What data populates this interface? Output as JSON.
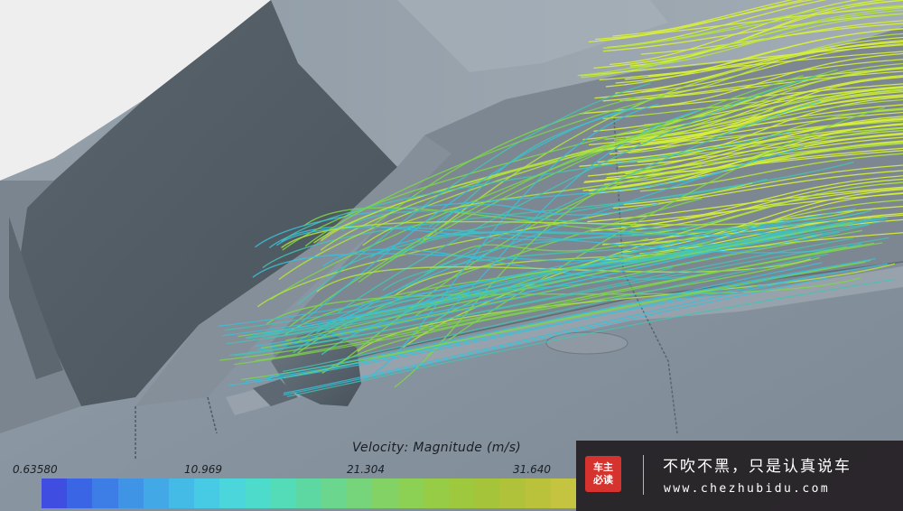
{
  "legend": {
    "title": "Velocity: Magnitude (m/s)",
    "ticks": [
      "0.63580",
      "10.969",
      "21.304",
      "31.640"
    ],
    "colors": [
      "#3f4ee0",
      "#3a66e6",
      "#3c7ee6",
      "#3f94e6",
      "#42a8e6",
      "#44bbe6",
      "#47cbe4",
      "#4ad6da",
      "#4ddccc",
      "#54dcb8",
      "#5ed8a2",
      "#6ad68e",
      "#76d47a",
      "#82d266",
      "#8cd054",
      "#96cc46",
      "#9ec83e",
      "#a6c43a",
      "#b0c23a",
      "#bac23c",
      "#c4c440"
    ]
  },
  "watermark": {
    "badge_line1": "车主",
    "badge_line2": "必读",
    "slogan": "不吹不黑，只是认真说车",
    "url": "www.chezhubidu.com",
    "badge_color": "#d6322e"
  },
  "scene": {
    "body_color": "#8a96a0",
    "glass_color": "#4e585f",
    "streamline_colors": [
      "#d8ef3a",
      "#b4e43c",
      "#7ed64a",
      "#44c4b4",
      "#3ac0d8"
    ]
  }
}
